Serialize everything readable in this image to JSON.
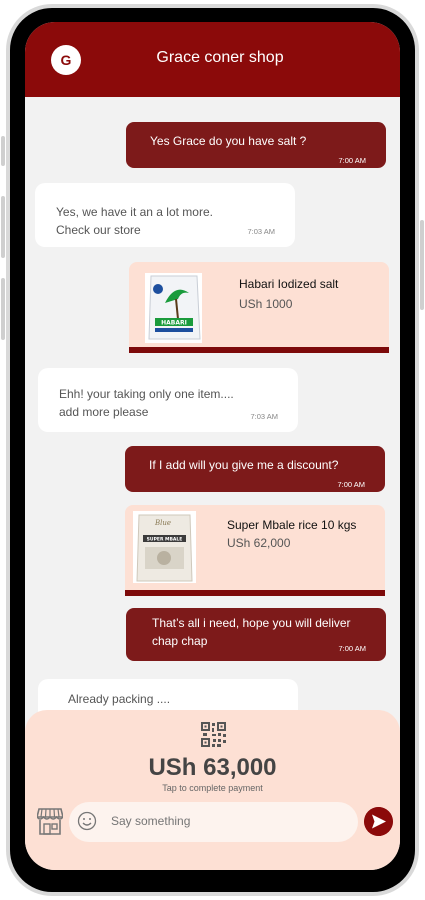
{
  "header": {
    "avatar_letter": "G",
    "title": "Grace coner shop"
  },
  "messages": [
    {
      "type": "sent",
      "text": "Yes Grace do you have salt ?",
      "time": "7:00 AM"
    },
    {
      "type": "received",
      "lines": [
        "Yes, we have it an a lot more.",
        "Check our  store"
      ],
      "time": "7:03 AM"
    },
    {
      "type": "product",
      "name": "Habari Iodized salt",
      "price": "USh 1000",
      "image_text": "HABARI"
    },
    {
      "type": "received",
      "lines": [
        "Ehh! your taking only one item....",
        "add more please"
      ],
      "time": "7:03 AM"
    },
    {
      "type": "sent",
      "text": "If I add will you give me a discount?",
      "time": "7:00 AM"
    },
    {
      "type": "product",
      "name": "Super Mbale rice 10  kgs",
      "price": "USh 62,000",
      "image_text": "SUPER MBALE"
    },
    {
      "type": "sent",
      "lines": [
        "That’s all i need, hope you will deliver",
        "chap chap"
      ],
      "time": "7:00 AM"
    },
    {
      "type": "received",
      "text": "Already packing ...."
    }
  ],
  "footer": {
    "total": "USh 63,000",
    "tap_text": "Tap to complete payment",
    "input_placeholder": "Say something"
  },
  "colors": {
    "brand": "#8b0a0a",
    "sent_bubble": "#7d1a1a",
    "product_bg": "#fde0d4",
    "chat_bg": "#f2f2f2"
  },
  "icons": [
    "qr-code-icon",
    "store-icon",
    "emoji-icon",
    "send-icon"
  ]
}
